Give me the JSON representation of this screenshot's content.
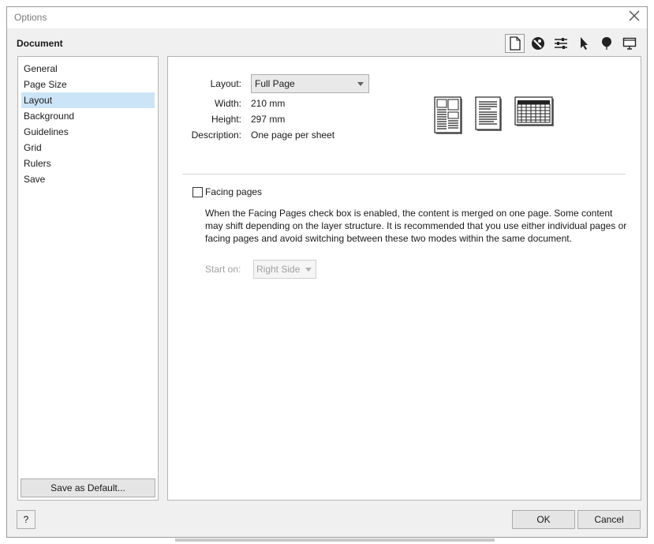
{
  "window": {
    "title": "Options",
    "close_icon": "close-icon"
  },
  "section_title": "Document",
  "toolbar": {
    "icons": [
      "document-icon",
      "globe-icon",
      "settings-icon",
      "pointer-icon",
      "balloon-icon",
      "monitor-icon"
    ],
    "active": "document-icon"
  },
  "sidebar": {
    "items": [
      {
        "label": "General"
      },
      {
        "label": "Page Size"
      },
      {
        "label": "Layout"
      },
      {
        "label": "Background"
      },
      {
        "label": "Guidelines"
      },
      {
        "label": "Grid"
      },
      {
        "label": "Rulers"
      },
      {
        "label": "Save"
      }
    ],
    "selected": "Layout",
    "save_default_label": "Save as Default..."
  },
  "layout_panel": {
    "layout_label": "Layout:",
    "layout_value": "Full Page",
    "width_label": "Width:",
    "width_value": "210 mm",
    "height_label": "Height:",
    "height_value": "297 mm",
    "description_label": "Description:",
    "description_value": "One page per sheet",
    "preview_icons": [
      "newspaper-layout-icon",
      "single-page-layout-icon",
      "table-layout-icon"
    ],
    "facing_pages_label": "Facing pages",
    "facing_pages_checked": false,
    "facing_pages_description": "When the Facing Pages check box is enabled, the content is merged on one page. Some content may shift depending on the layer structure. It is recommended that you use either individual pages or facing pages and avoid switching between these two modes within the same document.",
    "start_on_label": "Start on:",
    "start_on_value": "Right Side"
  },
  "buttons": {
    "help": "?",
    "ok": "OK",
    "cancel": "Cancel"
  }
}
